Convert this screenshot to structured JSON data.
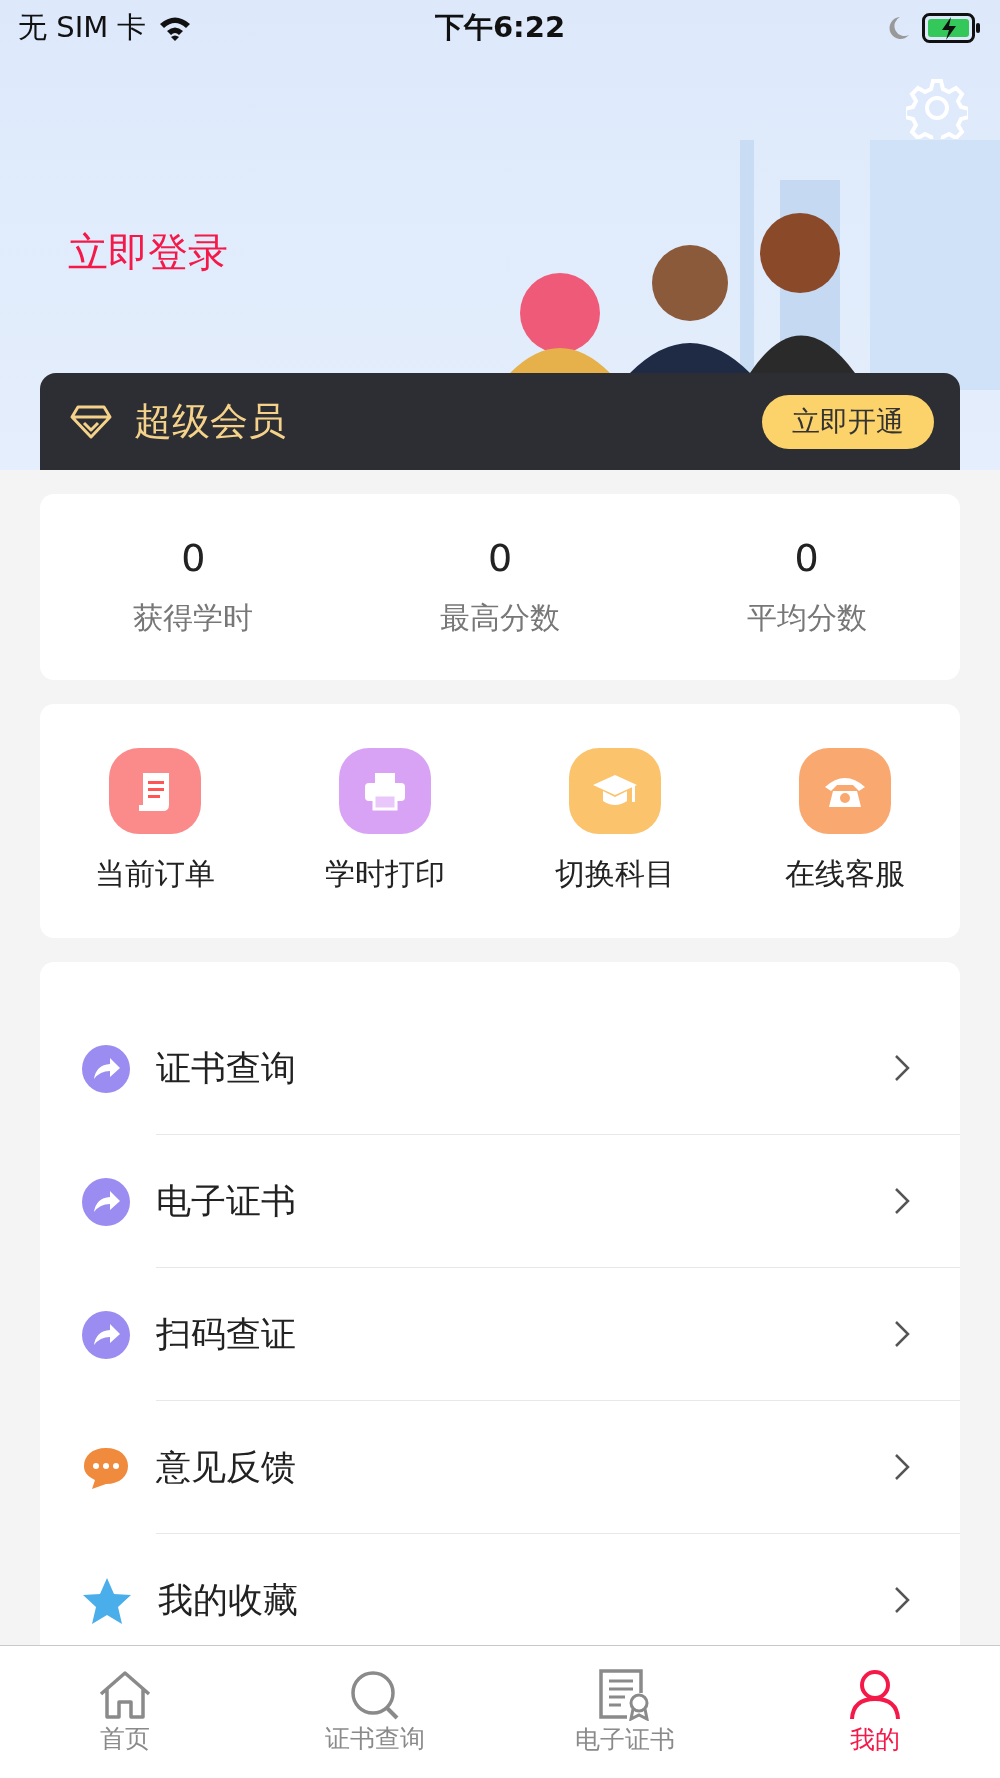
{
  "status_bar": {
    "carrier": "无 SIM 卡",
    "time": "下午6:22"
  },
  "header": {
    "login_link": "立即登录"
  },
  "vip_bar": {
    "title": "超级会员",
    "button": "立即开通"
  },
  "stats": [
    {
      "value": "0",
      "label": "获得学时"
    },
    {
      "value": "0",
      "label": "最高分数"
    },
    {
      "value": "0",
      "label": "平均分数"
    }
  ],
  "shortcuts": [
    {
      "label": "当前订单",
      "kind": "order",
      "color": "#fb8a8a"
    },
    {
      "label": "学时打印",
      "kind": "print",
      "color": "#d9a3f5"
    },
    {
      "label": "切换科目",
      "kind": "subject",
      "color": "#fbc36b"
    },
    {
      "label": "在线客服",
      "kind": "service",
      "color": "#f9a870"
    }
  ],
  "menu": [
    {
      "label": "证书查询",
      "kind": "arrow"
    },
    {
      "label": "电子证书",
      "kind": "arrow"
    },
    {
      "label": "扫码查证",
      "kind": "arrow"
    },
    {
      "label": "意见反馈",
      "kind": "chat"
    },
    {
      "label": "我的收藏",
      "kind": "star"
    }
  ],
  "tabs": [
    {
      "label": "首页",
      "kind": "home",
      "selected": false
    },
    {
      "label": "证书查询",
      "kind": "search",
      "selected": false
    },
    {
      "label": "电子证书",
      "kind": "certificate",
      "selected": false
    },
    {
      "label": "我的",
      "kind": "profile",
      "selected": true
    }
  ]
}
